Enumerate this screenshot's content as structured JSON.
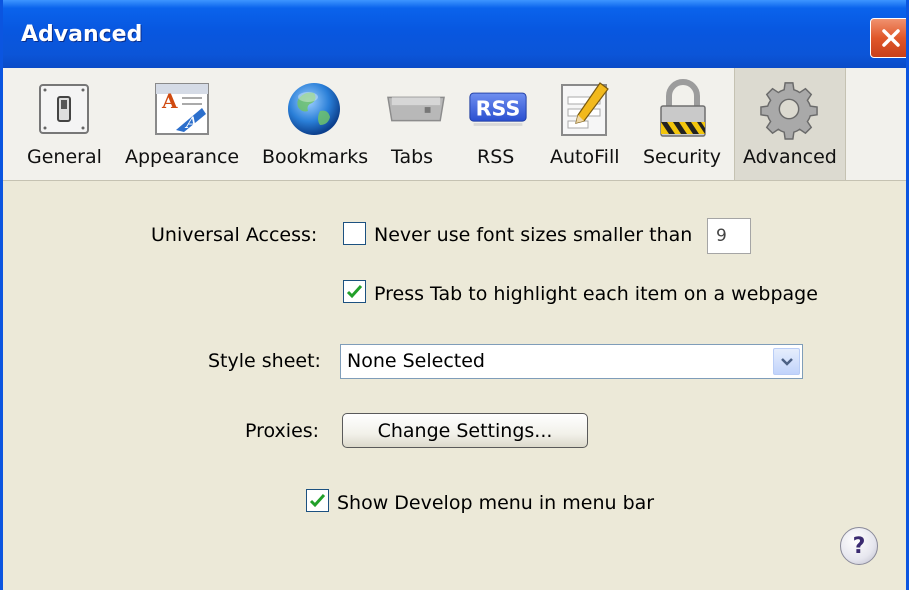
{
  "window": {
    "title": "Advanced"
  },
  "toolbar": {
    "tabs": [
      {
        "label": "General",
        "icon": "switch-icon"
      },
      {
        "label": "Appearance",
        "icon": "font-icon"
      },
      {
        "label": "Bookmarks",
        "icon": "globe-icon"
      },
      {
        "label": "Tabs",
        "icon": "tabs-icon"
      },
      {
        "label": "RSS",
        "icon": "rss-icon"
      },
      {
        "label": "AutoFill",
        "icon": "pencil-form-icon"
      },
      {
        "label": "Security",
        "icon": "lock-icon"
      },
      {
        "label": "Advanced",
        "icon": "gear-icon",
        "selected": true
      }
    ]
  },
  "universal_access": {
    "label": "Universal Access:",
    "font_size_option": "Never use font sizes smaller than",
    "font_size_checked": false,
    "font_size_value": "9",
    "tab_highlight_option": "Press Tab to highlight each item on a webpage",
    "tab_highlight_checked": true
  },
  "style_sheet": {
    "label": "Style sheet:",
    "selected": "None Selected"
  },
  "proxies": {
    "label": "Proxies:",
    "button": "Change Settings..."
  },
  "develop_menu": {
    "label": "Show Develop menu in menu bar",
    "checked": true
  },
  "help": {
    "label": "?"
  },
  "colors": {
    "titlebar": "#0857e0",
    "background": "#ece9d8",
    "check": "#22a02a"
  }
}
